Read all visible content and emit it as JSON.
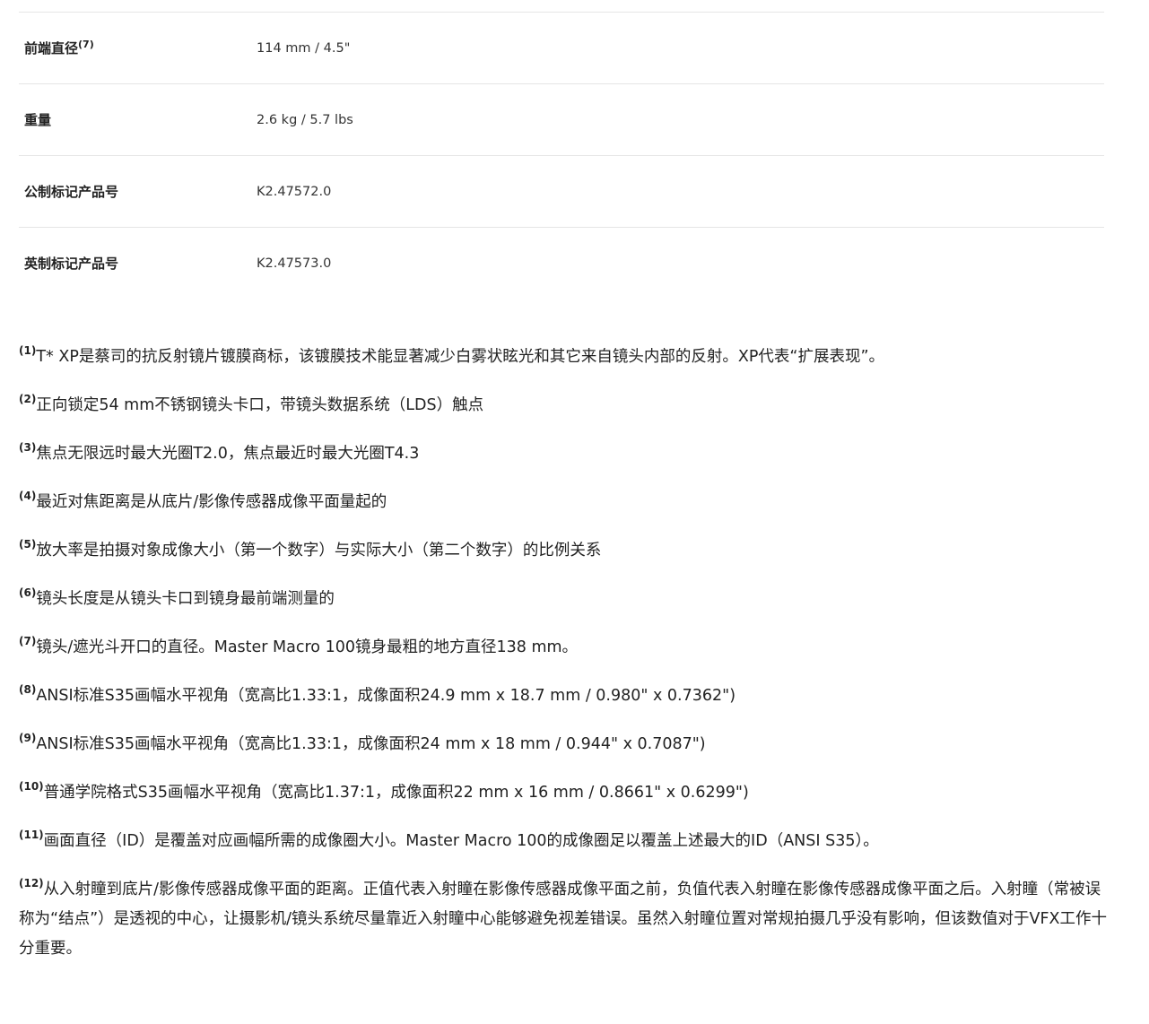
{
  "specs": [
    {
      "label": "前端直径",
      "note": "(7)",
      "value": "114 mm / 4.5\""
    },
    {
      "label": "重量",
      "note": "",
      "value": "2.6 kg / 5.7 lbs"
    },
    {
      "label": "公制标记产品号",
      "note": "",
      "value": "K2.47572.0"
    },
    {
      "label": "英制标记产品号",
      "note": "",
      "value": "K2.47573.0"
    }
  ],
  "footnotes": [
    {
      "mark": "(1)",
      "text": "T* XP是蔡司的抗反射镜片镀膜商标，该镀膜技术能显著减少白雾状眩光和其它来自镜头内部的反射。XP代表“扩展表现”。"
    },
    {
      "mark": "(2)",
      "text": "正向锁定54 mm不锈钢镜头卡口，带镜头数据系统（LDS）触点"
    },
    {
      "mark": "(3)",
      "text": "焦点无限远时最大光圈T2.0，焦点最近时最大光圈T4.3"
    },
    {
      "mark": "(4)",
      "text": "最近对焦距离是从底片/影像传感器成像平面量起的"
    },
    {
      "mark": "(5)",
      "text": "放大率是拍摄对象成像大小（第一个数字）与实际大小（第二个数字）的比例关系"
    },
    {
      "mark": "(6)",
      "text": "镜头长度是从镜头卡口到镜身最前端测量的"
    },
    {
      "mark": "(7)",
      "text": "镜头/遮光斗开口的直径。Master Macro 100镜身最粗的地方直径138 mm。"
    },
    {
      "mark": "(8)",
      "text": "ANSI标准S35画幅水平视角（宽高比1.33:1，成像面积24.9 mm x 18.7 mm / 0.980\" x 0.7362\")"
    },
    {
      "mark": "(9)",
      "text": "ANSI标准S35画幅水平视角（宽高比1.33:1，成像面积24 mm x 18 mm / 0.944\" x 0.7087\")"
    },
    {
      "mark": "(10)",
      "text": "普通学院格式S35画幅水平视角（宽高比1.37:1，成像面积22 mm x 16 mm / 0.8661\" x 0.6299\")"
    },
    {
      "mark": "(11)",
      "text": "画面直径（ID）是覆盖对应画幅所需的成像圈大小。Master Macro 100的成像圈足以覆盖上述最大的ID（ANSI S35）。"
    },
    {
      "mark": "(12)",
      "text": "从入射瞳到底片/影像传感器成像平面的距离。正值代表入射瞳在影像传感器成像平面之前，负值代表入射瞳在影像传感器成像平面之后。入射瞳（常被误称为“结点”）是透视的中心，让摄影机/镜头系统尽量靠近入射瞳中心能够避免视差错误。虽然入射瞳位置对常规拍摄几乎没有影响，但该数值对于VFX工作十分重要。"
    }
  ]
}
